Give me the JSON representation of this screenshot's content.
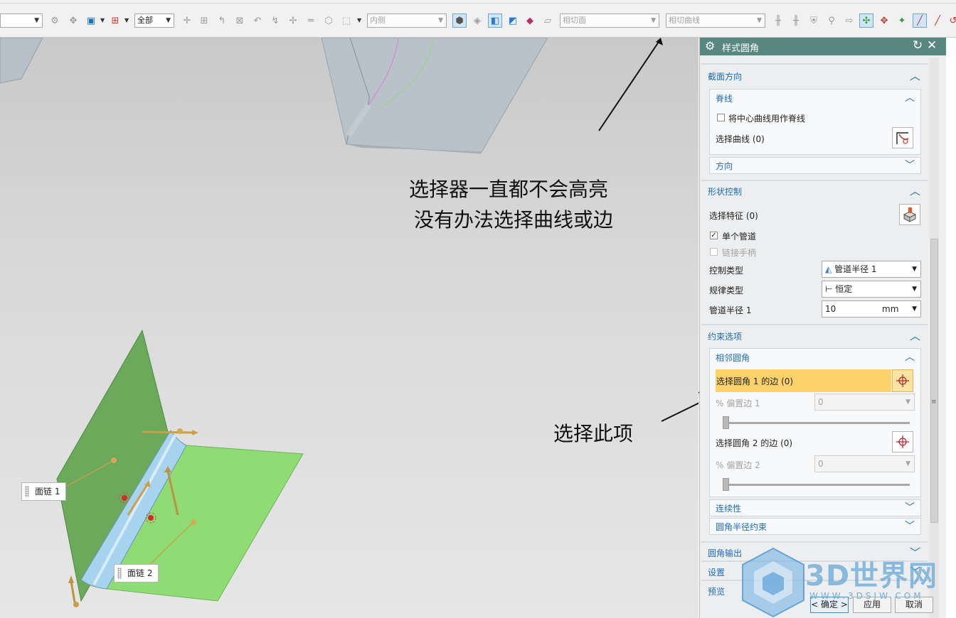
{
  "toolbar": {
    "filter_value": "",
    "scope_select": "全部",
    "inside_select": "内侧",
    "tangent_face_select": "相切面",
    "tangent_curve_select": "相切曲线"
  },
  "viewport": {
    "annotation_line1": "选择器一直都不会高亮",
    "annotation_line2": "没有办法选择曲线或边",
    "annotation_select": "选择此项",
    "face_chain_1": "面链 1",
    "face_chain_2": "面链 2"
  },
  "dialog": {
    "title": "样式圆角",
    "section_direction": {
      "title": "截面方向",
      "spine": {
        "title": "脊线",
        "checkbox_label": "将中心曲线用作脊线",
        "checked": false,
        "select_curve": "选择曲线 (0)"
      },
      "orientation": "方向"
    },
    "section_shape": {
      "title": "形状控制",
      "select_feature": "选择特征 (0)",
      "single_pipe_label": "单个管道",
      "single_pipe_checked": true,
      "link_handle_label": "链接手柄",
      "control_type_label": "控制类型",
      "control_type_value": "管道半径 1",
      "law_type_label": "规律类型",
      "law_type_value": "恒定",
      "pipe_radius_label": "管道半径 1",
      "pipe_radius_value": "10",
      "pipe_radius_unit": "mm"
    },
    "section_constraints": {
      "title": "约束选项",
      "adjacent": {
        "title": "相邻圆角",
        "select_edge_1": "选择圆角 1 的边 (0)",
        "offset_1_label": "% 偏置边 1",
        "offset_1_value": "0",
        "offset_1_slider": 0,
        "select_edge_2": "选择圆角 2 的边 (0)",
        "offset_2_label": "% 偏置边 2",
        "offset_2_value": "0",
        "offset_2_slider": 0
      },
      "continuity": "连续性",
      "radius_constraint": "圆角半径约束"
    },
    "section_output": "圆角输出",
    "section_settings": "设置",
    "section_preview": "预览",
    "buttons": {
      "ok": "< 确定 >",
      "apply": "应用",
      "cancel": "取消"
    }
  },
  "watermark": {
    "text": "3D世界网",
    "url": "WWW.3DSJW.COM"
  },
  "colors": {
    "title_bar": "#57877e",
    "section_blue": "#1e6bb8",
    "highlight": "#fbd36a",
    "face_green": "#8fdc75",
    "wall_green": "#6aaa5a",
    "fillet_blue": "#a8d3ef"
  }
}
